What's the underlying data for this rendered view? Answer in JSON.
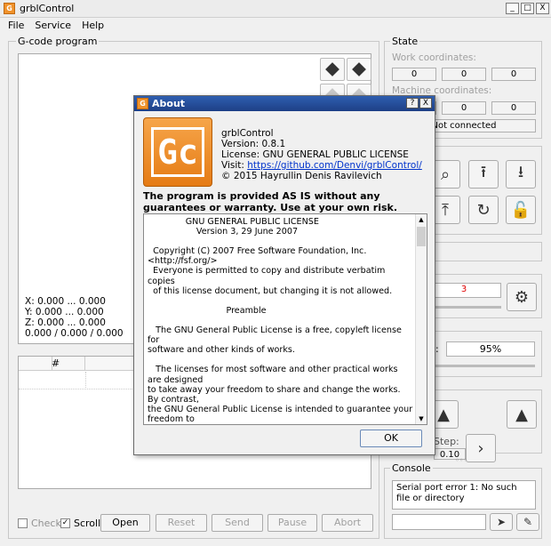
{
  "window": {
    "title": "grblControl",
    "min": "_",
    "max": "□",
    "close": "X"
  },
  "menu": [
    "File",
    "Service",
    "Help"
  ],
  "gcode": {
    "title": "G-code program",
    "coords": [
      "X: 0.000 ... 0.000",
      "Y: 0.000 ... 0.000",
      "Z: 0.000 ... 0.000",
      "0.000 / 0.000 / 0.000"
    ],
    "table_header": "#"
  },
  "bottom": {
    "check": "Check",
    "scroll": "Scroll",
    "open": "Open",
    "reset": "Reset",
    "send": "Send",
    "pause": "Pause",
    "abort": "Abort"
  },
  "state": {
    "title": "State",
    "work_label": "Work coordinates:",
    "work": [
      "0",
      "0",
      "0"
    ],
    "machine_label": "Machine coordinates:",
    "machine": [
      "0",
      "0",
      "0"
    ],
    "status": "Not connected"
  },
  "spindle": {
    "value": "3",
    "percent": "95%",
    "percent_label_tail": ":",
    "step_label_tail": "Step:",
    "step_value": "0.10"
  },
  "console": {
    "title": "Console",
    "message": "Serial port error 1: No such file or directory"
  },
  "about": {
    "title": "About",
    "help": "?",
    "close": "X",
    "logo": "Gc",
    "app": "grblControl",
    "version": "Version: 0.8.1",
    "license": "License: GNU GENERAL PUBLIC LICENSE",
    "visit_label": "Visit:",
    "visit_url": "https://github.com/Denvi/grblControl/",
    "copyright": "© 2015 Hayrullin Denis Ravilevich",
    "warning": "The program is provided AS IS without any guarantees or warranty. Use at your own risk.",
    "license_text": "              GNU GENERAL PUBLIC LICENSE\n                  Version 3, 29 June 2007\n\n  Copyright (C) 2007 Free Software Foundation, Inc. <http://fsf.org/>\n  Everyone is permitted to copy and distribute verbatim copies\n  of this license document, but changing it is not allowed.\n\n                             Preamble\n\n   The GNU General Public License is a free, copyleft license for\nsoftware and other kinds of works.\n\n   The licenses for most software and other practical works are designed\nto take away your freedom to share and change the works.  By contrast,\nthe GNU General Public License is intended to guarantee your freedom to\nshare and change all versions of a program--to make sure it remains free\nsoftware for all its users.  We, the Free Software Foundation, use the\nGNU General Public License for most of our software; it applies also to",
    "ok": "OK"
  }
}
